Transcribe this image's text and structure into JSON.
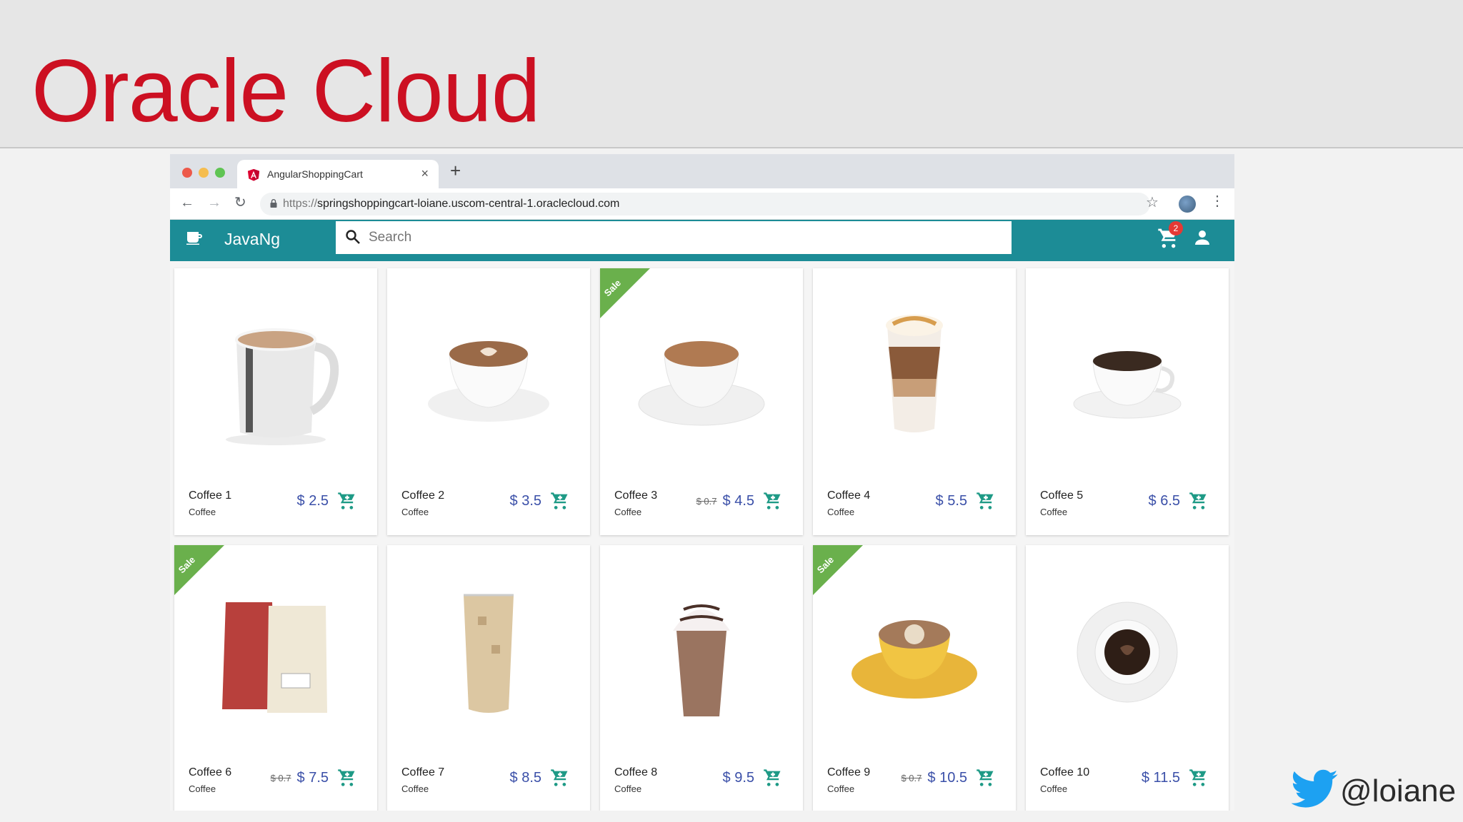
{
  "slide": {
    "title": "Oracle Cloud",
    "handle": "@loiane"
  },
  "browser": {
    "tab_title": "AngularShoppingCart",
    "url_scheme": "https://",
    "url_rest": "springshoppingcart-loiane.uscom-central-1.oraclecloud.com"
  },
  "app": {
    "brand": "JavaNg",
    "search_placeholder": "Search",
    "cart_count": "2"
  },
  "colors": {
    "toolbar": "#1c8c96",
    "price": "#3a4fa8",
    "sale": "#6ab04c",
    "cart_icon": "#1e9a86",
    "title": "#cc1022"
  },
  "products": [
    {
      "name": "Coffee 1",
      "category": "Coffee",
      "price": "$ 2.5",
      "old_price": "",
      "sale": false,
      "sale_label": ""
    },
    {
      "name": "Coffee 2",
      "category": "Coffee",
      "price": "$ 3.5",
      "old_price": "",
      "sale": false,
      "sale_label": ""
    },
    {
      "name": "Coffee 3",
      "category": "Coffee",
      "price": "$ 4.5",
      "old_price": "$ 0.7",
      "sale": true,
      "sale_label": "Sale"
    },
    {
      "name": "Coffee 4",
      "category": "Coffee",
      "price": "$ 5.5",
      "old_price": "",
      "sale": false,
      "sale_label": ""
    },
    {
      "name": "Coffee 5",
      "category": "Coffee",
      "price": "$ 6.5",
      "old_price": "",
      "sale": false,
      "sale_label": ""
    },
    {
      "name": "Coffee 6",
      "category": "Coffee",
      "price": "$ 7.5",
      "old_price": "$ 0.7",
      "sale": true,
      "sale_label": "Sale"
    },
    {
      "name": "Coffee 7",
      "category": "Coffee",
      "price": "$ 8.5",
      "old_price": "",
      "sale": false,
      "sale_label": ""
    },
    {
      "name": "Coffee 8",
      "category": "Coffee",
      "price": "$ 9.5",
      "old_price": "",
      "sale": false,
      "sale_label": ""
    },
    {
      "name": "Coffee 9",
      "category": "Coffee",
      "price": "$ 10.5",
      "old_price": "$ 0.7",
      "sale": true,
      "sale_label": "Sale"
    },
    {
      "name": "Coffee 10",
      "category": "Coffee",
      "price": "$ 11.5",
      "old_price": "",
      "sale": false,
      "sale_label": ""
    }
  ]
}
